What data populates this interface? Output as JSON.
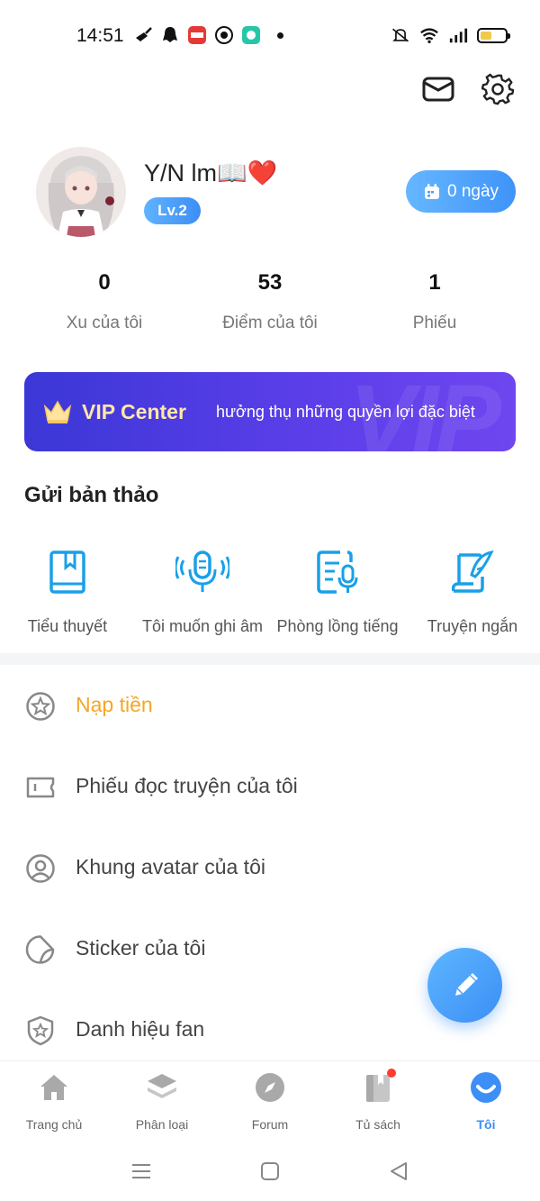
{
  "status_bar": {
    "time": "14:51"
  },
  "profile": {
    "username": "Y/N lm📖❤️",
    "level": "Lv.2",
    "checkin_label": "0 ngày"
  },
  "stats": [
    {
      "value": "0",
      "label": "Xu của tôi"
    },
    {
      "value": "53",
      "label": "Điểm của tôi"
    },
    {
      "value": "1",
      "label": "Phiếu"
    }
  ],
  "vip": {
    "title": "VIP Center",
    "subtitle": "hưởng thụ những quyền lợi đặc biệt",
    "watermark": "VIP"
  },
  "drafts": {
    "title": "Gửi bản thảo",
    "items": [
      {
        "label": "Tiểu thuyết",
        "icon": "book-icon"
      },
      {
        "label": "Tôi muốn ghi âm",
        "icon": "microphone-icon"
      },
      {
        "label": "Phòng lồng tiếng",
        "icon": "dubbing-icon"
      },
      {
        "label": "Truyện ngắn",
        "icon": "quill-icon"
      }
    ]
  },
  "menu": [
    {
      "label": "Nạp tiền",
      "icon": "coin-star-icon",
      "highlight": true
    },
    {
      "label": "Phiếu đọc truyện của tôi",
      "icon": "ticket-icon"
    },
    {
      "label": "Khung avatar của tôi",
      "icon": "avatar-frame-icon"
    },
    {
      "label": "Sticker của tôi",
      "icon": "sticker-icon"
    },
    {
      "label": "Danh hiệu fan",
      "icon": "shield-star-icon"
    }
  ],
  "bottom_nav": [
    {
      "label": "Trang chủ",
      "icon": "home-icon"
    },
    {
      "label": "Phân loại",
      "icon": "layers-icon"
    },
    {
      "label": "Forum",
      "icon": "compass-icon"
    },
    {
      "label": "Tủ sách",
      "icon": "bookshelf-icon",
      "badge": true
    },
    {
      "label": "Tôi",
      "icon": "profile-icon",
      "active": true
    }
  ],
  "colors": {
    "accent": "#3d8ef5",
    "highlight": "#f5a623",
    "vip_start": "#3b37d6",
    "vip_end": "#6f46f0",
    "draft_icon": "#1aa0e8"
  }
}
